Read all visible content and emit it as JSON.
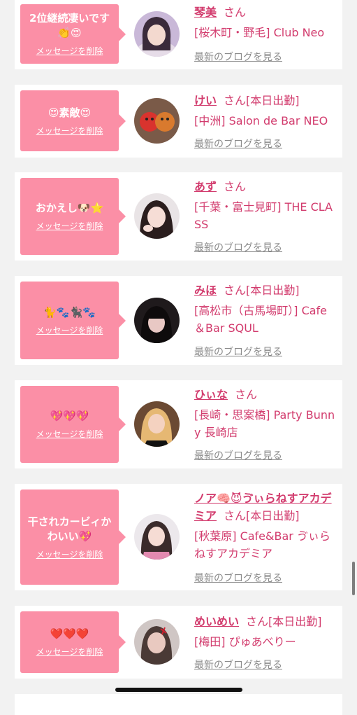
{
  "cards": [
    {
      "message": "2位継続凄いです👏😍",
      "delete_label": "メッセージを削除",
      "name": "琴美",
      "honorific": "さん",
      "status": "",
      "shop": "[桜木町・野毛] Club Neo",
      "blog_label": "最新のブログを見る"
    },
    {
      "message": "😍素敵😍",
      "delete_label": "メッセージを削除",
      "name": "けい",
      "honorific": "さん",
      "status": "[本日出勤]",
      "shop": "[中洲] Salon de Bar NEO",
      "blog_label": "最新のブログを見る"
    },
    {
      "message": "おかえし🐶⭐",
      "delete_label": "メッセージを削除",
      "name": "あず",
      "honorific": "さん",
      "status": "",
      "shop": "[千葉・富士見町] THE CLASS",
      "blog_label": "最新のブログを見る"
    },
    {
      "message": "🐈🐾🐈‍⬛🐾",
      "delete_label": "メッセージを削除",
      "name": "みほ",
      "honorific": "さん",
      "status": "[本日出勤]",
      "shop": "[高松市（古馬場町）] Cafe＆Bar SQUL",
      "blog_label": "最新のブログを見る"
    },
    {
      "message": "💖💖💖",
      "delete_label": "メッセージを削除",
      "name": "ひぃな",
      "honorific": "さん",
      "status": "",
      "shop": "[長崎・思案橋] Party Bunny 長崎店",
      "blog_label": "最新のブログを見る"
    },
    {
      "message": "干されカービィかわいい💖",
      "delete_label": "メッセージを削除",
      "name": "ノア🧠😈ゔぃらねすアカデミア",
      "honorific": "さん",
      "status": "[本日出勤]",
      "shop": "[秋葉原] Cafe&Bar ゔぃらねすアカデミア",
      "blog_label": "最新のブログを見る"
    },
    {
      "message": "❤️❤️❤️",
      "delete_label": "メッセージを削除",
      "name": "めいめい",
      "honorific": "さん",
      "status": "[本日出勤]",
      "shop": "[梅田] ぴゅあべりー",
      "blog_label": "最新のブログを見る"
    }
  ],
  "colors": {
    "accent": "#d23b6d",
    "bubble": "#fb8fa6",
    "link_gray": "#8a8a8a",
    "background": "#f2f2f2"
  }
}
